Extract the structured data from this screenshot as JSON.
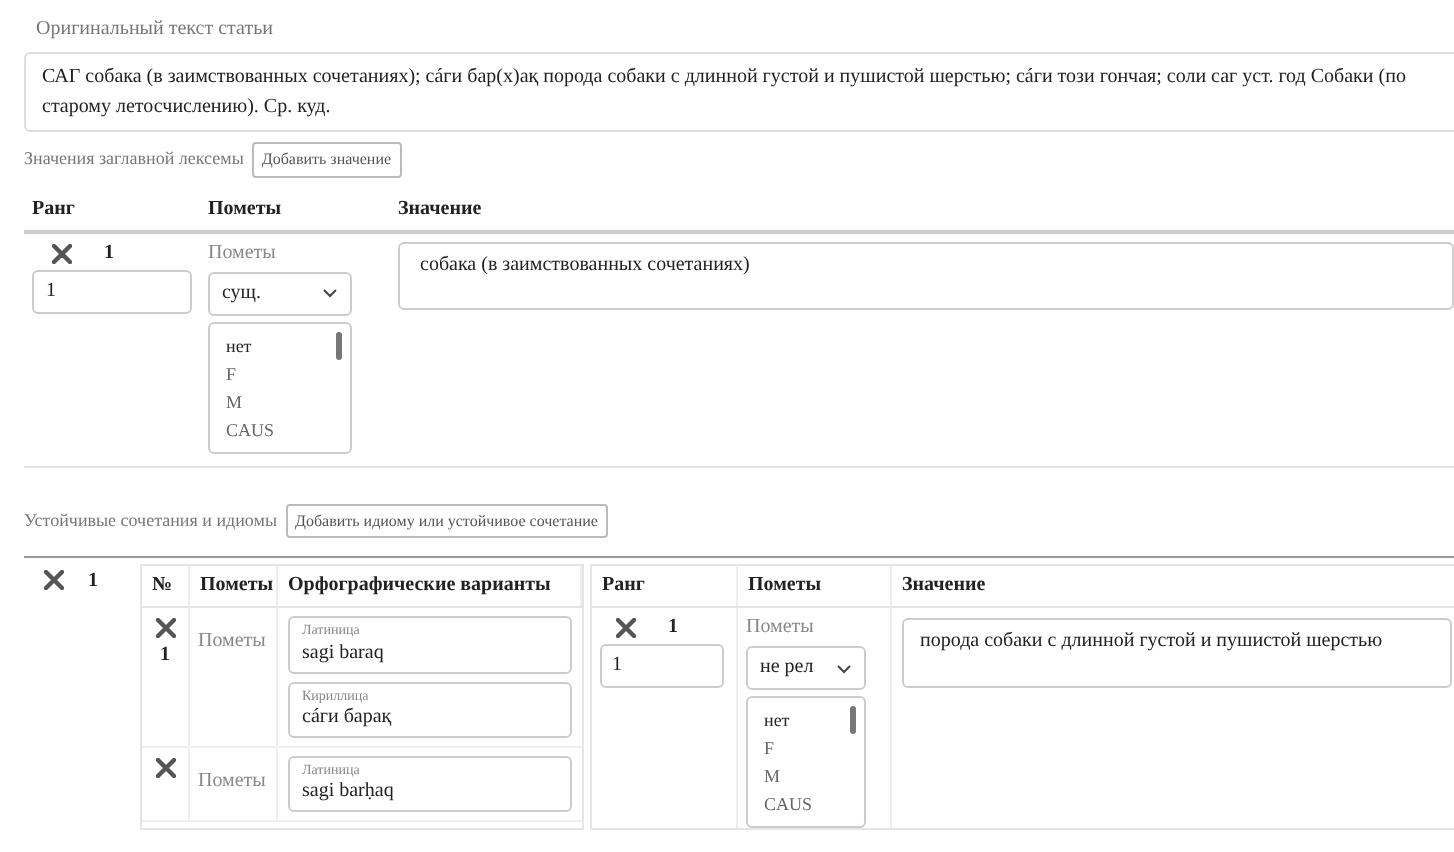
{
  "original_text": {
    "label": "Оригинальный текст статьи",
    "value": "САГ собака (в заимствованных сочетаниях); сáги бар(х)ақ порода собаки с длинной густой и пушистой шерстью; сáги този гончая; соли саг уст. год Собаки (по старому летосчислению). Ср. куд."
  },
  "meanings": {
    "label": "Значения заглавной лексемы",
    "add_button": "Добавить значение",
    "columns": [
      "Ранг",
      "Пометы",
      "Значение"
    ],
    "rows": [
      {
        "number": "1",
        "rank": "1",
        "marks_label": "Пометы",
        "marks_select": "сущ.",
        "marks_options": [
          "нет",
          "F",
          "M",
          "CAUS"
        ],
        "meaning": "собака (в заимствованных сочетаниях)"
      }
    ]
  },
  "idioms": {
    "label": "Устойчивые сочетания и идиомы",
    "add_button": "Добавить идиому или устойчивое сочетание",
    "items": [
      {
        "number": "1",
        "variant_columns": [
          "№",
          "Пометы",
          "Орфографические варианты"
        ],
        "variants": [
          {
            "number": "1",
            "marks_label": "Пометы",
            "spellings": [
              {
                "script": "Латиница",
                "value": "sagi baraq"
              },
              {
                "script": "Кириллица",
                "value": "сáги барақ"
              }
            ]
          },
          {
            "marks_label": "Пометы",
            "spellings": [
              {
                "script": "Латиница",
                "value": "sagi barḥaq"
              }
            ]
          }
        ],
        "meaning_columns": [
          "Ранг",
          "Пометы",
          "Значение"
        ],
        "meanings": [
          {
            "number": "1",
            "rank": "1",
            "marks_label": "Пометы",
            "marks_select": "не рел",
            "marks_options": [
              "нет",
              "F",
              "M",
              "CAUS"
            ],
            "meaning": "порода собаки с длинной густой и пушистой шерстью"
          }
        ]
      }
    ]
  }
}
